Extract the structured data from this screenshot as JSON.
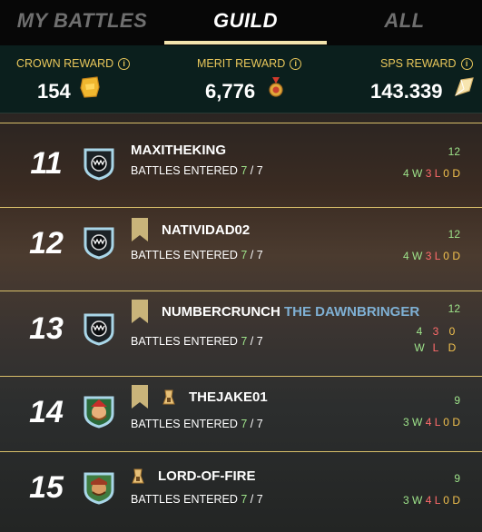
{
  "tabs": [
    "MY BATTLES",
    "GUILD",
    "ALL"
  ],
  "rewards": {
    "crown": {
      "label": "CROWN REWARD",
      "value": "154",
      "info_icon": "i"
    },
    "merit": {
      "label": "MERIT REWARD",
      "value": "6,776",
      "info_icon": "i"
    },
    "sps": {
      "label": "SPS REWARD",
      "value": "143.339",
      "info_icon": "i"
    }
  },
  "battles_label": "BATTLES ENTERED",
  "rows": [
    {
      "rank": "11",
      "name": "MAXITHEKING",
      "title": "",
      "entered": "7",
      "total": "7",
      "score": "12",
      "wins": "4",
      "losses": "3",
      "draws": "0"
    },
    {
      "rank": "12",
      "name": "NATIVIDAD02",
      "title": "",
      "entered": "7",
      "total": "7",
      "score": "12",
      "wins": "4",
      "losses": "3",
      "draws": "0"
    },
    {
      "rank": "13",
      "name": "NUMBERCRUNCH",
      "title": "THE DAWNBRINGER",
      "entered": "7",
      "total": "7",
      "score": "12",
      "wins": "4",
      "losses": "3",
      "draws": "0"
    },
    {
      "rank": "14",
      "name": "THEJAKE01",
      "title": "",
      "entered": "7",
      "total": "7",
      "score": "9",
      "wins": "3",
      "losses": "4",
      "draws": "0"
    },
    {
      "rank": "15",
      "name": "LORD-OF-FIRE",
      "title": "",
      "entered": "7",
      "total": "7",
      "score": "9",
      "wins": "3",
      "losses": "4",
      "draws": "0"
    }
  ],
  "wld_letters": {
    "w": "W",
    "l": "L",
    "d": "D"
  },
  "colors": {
    "tab_underline": "#f2e3ad",
    "reward_label": "#e9c75b",
    "win": "#9ee38a",
    "loss": "#ff6b6b",
    "draw": "#f2c14e",
    "row_divider": "#d8bf6a"
  }
}
